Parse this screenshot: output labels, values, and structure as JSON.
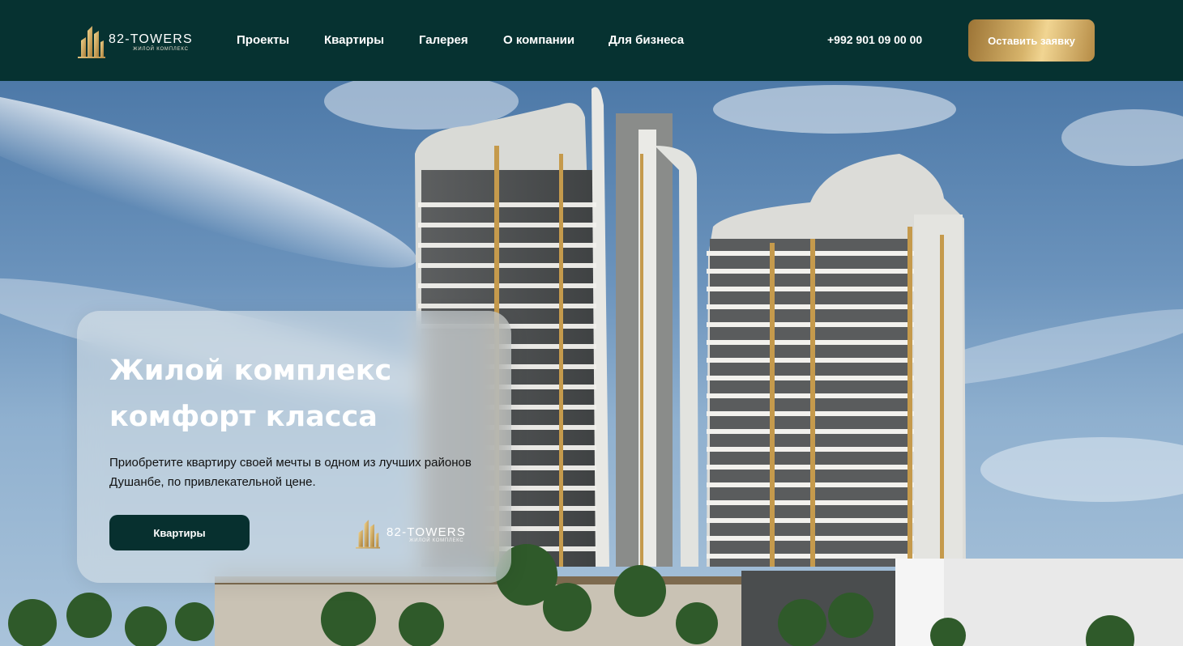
{
  "header": {
    "logo": {
      "brand": "82-TOWERS",
      "tagline": "ЖИЛОЙ КОМПЛЕКС"
    },
    "nav": [
      {
        "label": "Проекты"
      },
      {
        "label": "Квартиры"
      },
      {
        "label": "Галерея"
      },
      {
        "label": "О компании"
      },
      {
        "label": "Для бизнеса"
      }
    ],
    "phone": "+992 901 09 00 00",
    "cta_label": "Оставить заявку"
  },
  "hero": {
    "title_line1": "Жилой комплекс",
    "title_line2": "комфорт класса",
    "description": "Приобретите квартиру своей мечты в одном из лучших районов Душанбе, по привлекательной цене.",
    "button_label": "Квартиры",
    "card_logo": {
      "brand": "82-TOWERS",
      "tagline": "ЖИЛОЙ КОМПЛЕКС"
    }
  },
  "colors": {
    "header_bg": "#063231",
    "accent_gold": "#d7b46b",
    "button_dark": "#07302f"
  }
}
